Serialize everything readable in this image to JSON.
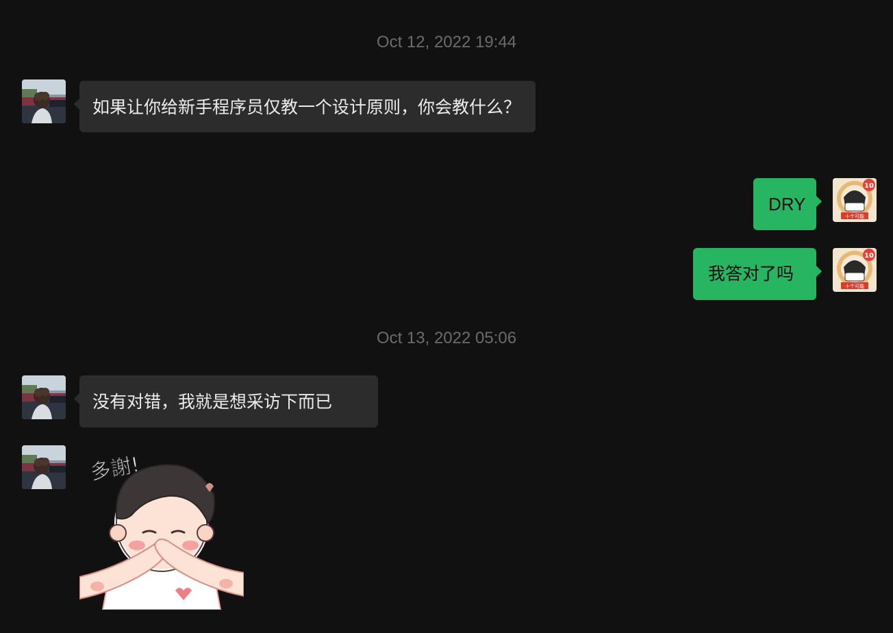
{
  "timestamps": [
    "Oct 12, 2022 19:44",
    "Oct 13, 2022 05:06"
  ],
  "messages": [
    {
      "sender": "contact",
      "text": "如果让你给新手程序员仅教一个设计原则，你会教什么？"
    },
    {
      "sender": "me",
      "text": "DRY"
    },
    {
      "sender": "me",
      "text": "我答对了吗"
    },
    {
      "sender": "contact",
      "text": "没有对错，我就是想采访下而已"
    },
    {
      "sender": "contact",
      "type": "sticker",
      "sticker_text": "多謝!"
    }
  ],
  "my_avatar": {
    "badge": "10",
    "caption": "十个可能"
  },
  "colors": {
    "background": "#111111",
    "incoming_bubble": "#2c2c2c",
    "outgoing_bubble": "#27b562",
    "timestamp": "#6b6b6b"
  }
}
